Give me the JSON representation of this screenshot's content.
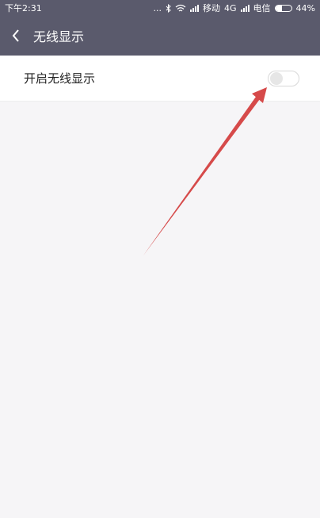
{
  "status_bar": {
    "time": "下午2:31",
    "dots": "...",
    "carrier1": "移动",
    "network": "4G",
    "carrier2": "电信",
    "battery": "44%",
    "battery_level": 0.44,
    "icons": [
      "bluetooth-icon",
      "wifi-icon",
      "signal-icon",
      "signal-icon",
      "battery-icon"
    ]
  },
  "header": {
    "back_icon": "chevron-left-icon",
    "title": "无线显示"
  },
  "settings": {
    "items": [
      {
        "label": "开启无线显示",
        "toggle_on": false
      }
    ]
  },
  "annotation": {
    "arrow_color": "#d64a4a"
  },
  "colors": {
    "header_bg": "#5a5a6c",
    "page_bg": "#f6f5f7",
    "row_bg": "#ffffff"
  }
}
